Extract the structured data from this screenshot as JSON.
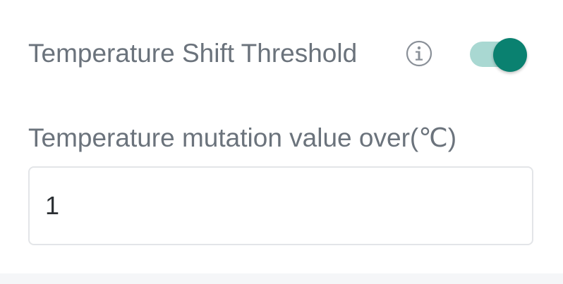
{
  "toggle_setting": {
    "label": "Temperature Shift Threshold",
    "info_icon": "info-circle-icon",
    "enabled": true
  },
  "mutation_field": {
    "label": "Temperature mutation value over(℃)",
    "value": "1"
  },
  "colors": {
    "accent": "#0a8170",
    "track_on": "#a9d8d2",
    "label_text": "#6b737c",
    "input_border": "#e3e5e8",
    "footer_band": "#f5f6f8"
  }
}
